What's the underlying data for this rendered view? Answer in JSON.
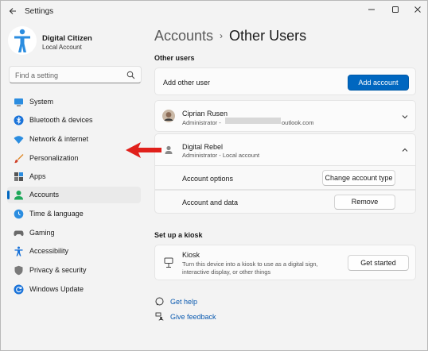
{
  "window": {
    "title": "Settings",
    "back_icon": "back-arrow-icon",
    "controls": [
      "minimize-icon",
      "maximize-icon",
      "close-icon"
    ]
  },
  "profile": {
    "name": "Digital Citizen",
    "account_type": "Local Account"
  },
  "search": {
    "placeholder": "Find a setting"
  },
  "sidebar": {
    "items": [
      {
        "label": "System",
        "icon": "monitor-icon",
        "active": false
      },
      {
        "label": "Bluetooth & devices",
        "icon": "bluetooth-icon",
        "active": false
      },
      {
        "label": "Network & internet",
        "icon": "wifi-icon",
        "active": false
      },
      {
        "label": "Personalization",
        "icon": "brush-icon",
        "active": false
      },
      {
        "label": "Apps",
        "icon": "apps-icon",
        "active": false
      },
      {
        "label": "Accounts",
        "icon": "person-icon",
        "active": true
      },
      {
        "label": "Time & language",
        "icon": "globe-clock-icon",
        "active": false
      },
      {
        "label": "Gaming",
        "icon": "gamepad-icon",
        "active": false
      },
      {
        "label": "Accessibility",
        "icon": "accessibility-icon",
        "active": false
      },
      {
        "label": "Privacy & security",
        "icon": "shield-icon",
        "active": false
      },
      {
        "label": "Windows Update",
        "icon": "update-icon",
        "active": false
      }
    ]
  },
  "breadcrumb": {
    "parent": "Accounts",
    "separator": "›",
    "current": "Other Users"
  },
  "other_users": {
    "heading": "Other users",
    "add_label": "Add other user",
    "add_button": "Add account",
    "users": [
      {
        "name": "Ciprian Rusen",
        "detail_prefix": "Administrator - ",
        "detail_suffix": "outlook.com",
        "expanded": false
      },
      {
        "name": "Digital Rebel",
        "detail": "Administrator - Local account",
        "expanded": true
      }
    ],
    "account_options_label": "Account options",
    "change_type_button": "Change account type",
    "account_data_label": "Account and data",
    "remove_button": "Remove"
  },
  "kiosk": {
    "heading": "Set up a kiosk",
    "title": "Kiosk",
    "description_line1": "Turn this device into a kiosk to use as a digital sign,",
    "description_line2": "interactive display, or other things",
    "button": "Get started"
  },
  "links": {
    "help": "Get help",
    "feedback": "Give feedback"
  },
  "colors": {
    "accent": "#0067c0",
    "annotation_arrow": "#e0201b"
  }
}
